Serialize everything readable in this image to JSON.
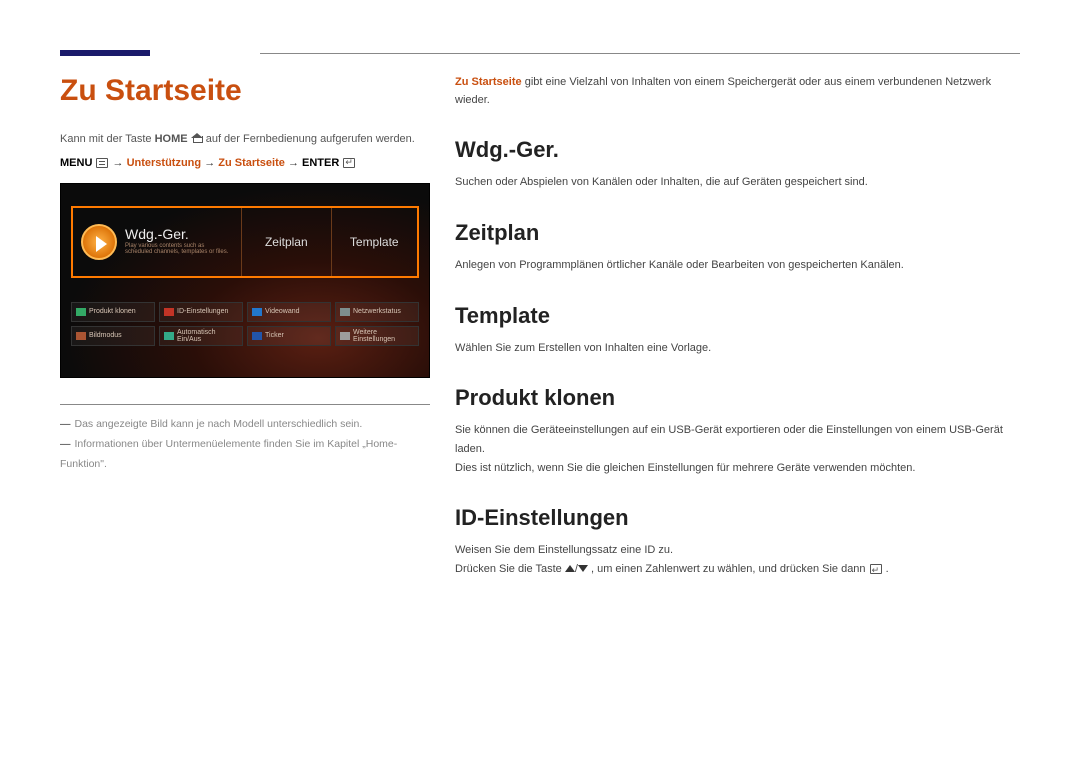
{
  "page_title": "Zu Startseite",
  "intro_pre": "Kann mit der Taste ",
  "intro_home": "HOME",
  "intro_post": " auf der Fernbedienung aufgerufen werden.",
  "menu_path": {
    "menu": "MENU",
    "arrow": " → ",
    "sup": "Unterstützung",
    "zu": "Zu Startseite",
    "enter": "ENTER"
  },
  "tv": {
    "wdg_title": "Wdg.-Ger.",
    "wdg_sub": "Play various contents such as scheduled channels, templates or files.",
    "zeitplan": "Zeitplan",
    "template": "Template",
    "small": [
      "Produkt klonen",
      "ID-Einstellungen",
      "Videowand",
      "Netzwerkstatus",
      "Bildmodus",
      "Automatisch Ein/Aus",
      "Ticker",
      "Weitere Einstellungen"
    ]
  },
  "footnotes": [
    "Das angezeigte Bild kann je nach Modell unterschiedlich sein.",
    "Informationen über Untermenüelemente finden Sie im Kapitel „Home-Funktion\"."
  ],
  "right_intro_strong": "Zu Startseite",
  "right_intro_rest": " gibt eine Vielzahl von Inhalten von einem Speichergerät oder aus einem verbundenen Netzwerk wieder.",
  "sections": {
    "wdg": {
      "h": "Wdg.-Ger.",
      "p": "Suchen oder Abspielen von Kanälen oder Inhalten, die auf Geräten gespeichert sind."
    },
    "zeit": {
      "h": "Zeitplan",
      "p": "Anlegen von Programmplänen örtlicher Kanäle oder Bearbeiten von gespeicherten Kanälen."
    },
    "tmpl": {
      "h": "Template",
      "p": "Wählen Sie zum Erstellen von Inhalten eine Vorlage."
    },
    "klonen": {
      "h": "Produkt klonen",
      "p1": "Sie können die Geräteeinstellungen auf ein USB-Gerät exportieren oder die Einstellungen von einem USB-Gerät laden.",
      "p2": "Dies ist nützlich, wenn Sie die gleichen Einstellungen für mehrere Geräte verwenden möchten."
    },
    "id": {
      "h": "ID-Einstellungen",
      "p1": "Weisen Sie dem Einstellungssatz eine ID zu.",
      "p2a": "Drücken Sie die Taste ",
      "p2b": ", um einen Zahlenwert zu wählen, und drücken Sie dann ",
      "p2c": "."
    }
  }
}
